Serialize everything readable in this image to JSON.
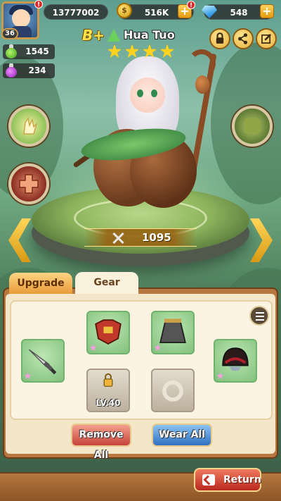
{
  "player": {
    "level": "36",
    "avatar_alert": "!"
  },
  "currencies": {
    "power_total": "13777002",
    "coins": "516K",
    "coins_alert": "!",
    "gems": "548",
    "plus_label": "+"
  },
  "resources": {
    "green_potion": "1545",
    "purple_potion": "234"
  },
  "hero": {
    "grade": "B+",
    "name": "Hua Tuo",
    "stars": 4,
    "power": "1095"
  },
  "tabs": [
    {
      "label": "Upgrade"
    },
    {
      "label": "Gear"
    }
  ],
  "gear": {
    "locked_slot_label": "LV.40",
    "remove_all_label": "Remove All",
    "wear_all_label": "Wear All"
  },
  "footer": {
    "return_label": "Return"
  },
  "colors": {
    "accent_gold": "#e7b13e",
    "panel_brown": "#b6783f",
    "slot_green": "#82c07d",
    "remove_red": "#c8433a",
    "wear_blue": "#2f6fc1"
  }
}
